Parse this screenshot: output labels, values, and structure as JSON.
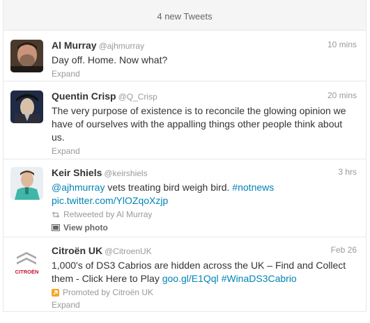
{
  "new_tweets_bar": "4 new Tweets",
  "tweets": [
    {
      "name": "Al Murray",
      "handle": "@ajhmurray",
      "time": "10 mins",
      "text": "Day off. Home. Now what?",
      "expand": "Expand"
    },
    {
      "name": "Quentin Crisp",
      "handle": "@Q_Crisp",
      "time": "20 mins",
      "text": "The very purpose of existence is to reconcile the glowing opinion we have of ourselves with the appalling things other people think about us.",
      "expand": "Expand"
    },
    {
      "name": "Keir Shiels",
      "handle": "@keirshiels",
      "time": "3 hrs",
      "mention": "@ajhmurray",
      "text_mid": " vets treating bird weigh bird. ",
      "hashtag": "#notnews",
      "pic_link": "pic.twitter.com/YlOZqoXzjp",
      "retweeted_by": "Retweeted by Al Murray",
      "view_photo": "View photo"
    },
    {
      "name": "Citroën UK",
      "handle": "@CitroenUK",
      "time": "Feb 26",
      "text": "1,000's of DS3 Cabrios are hidden across the UK – Find and Collect them - Click Here to Play ",
      "url": "goo.gl/E1Qql",
      "hashtag": "#WinaDS3Cabrio",
      "promoted": "Promoted by Citroën UK",
      "expand": "Expand",
      "logo_text": "CITROËN"
    }
  ],
  "colors": {
    "link": "#0084b4",
    "promo": "#f5a623"
  }
}
